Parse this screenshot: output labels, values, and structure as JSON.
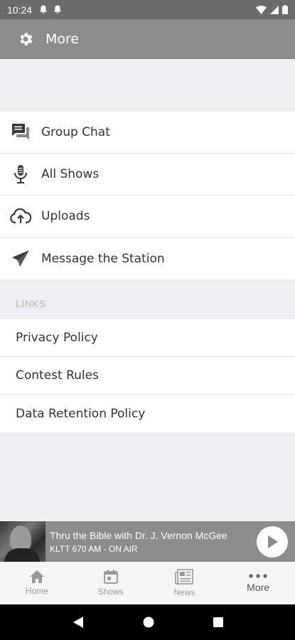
{
  "status_bar": {
    "time": "10:24"
  },
  "app_bar": {
    "title": "More",
    "icon": "gear-icon"
  },
  "menu": {
    "items": [
      {
        "label": "Group Chat",
        "icon": "chat-icon"
      },
      {
        "label": "All Shows",
        "icon": "microphone-icon"
      },
      {
        "label": "Uploads",
        "icon": "cloud-upload-icon"
      },
      {
        "label": "Message the Station",
        "icon": "send-icon"
      }
    ]
  },
  "links": {
    "header": "LINKS",
    "items": [
      {
        "label": "Privacy Policy"
      },
      {
        "label": "Contest Rules"
      },
      {
        "label": "Data Retention Policy"
      }
    ]
  },
  "player": {
    "title": "Thru the Bible with Dr. J. Vernon McGee",
    "station": "KLTT 670 AM - ON AIR"
  },
  "tabs": [
    {
      "label": "Home",
      "icon": "home-icon",
      "active": false
    },
    {
      "label": "Shows",
      "icon": "calendar-icon",
      "active": false
    },
    {
      "label": "News",
      "icon": "newspaper-icon",
      "active": false
    },
    {
      "label": "More",
      "icon": "more-dots-icon",
      "active": true
    }
  ],
  "colors": {
    "app_bar": "#8c8c8c",
    "status_bar": "#6b6b6b",
    "background": "#efeff3"
  }
}
